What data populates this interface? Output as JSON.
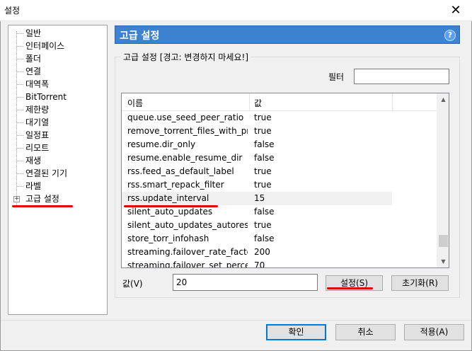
{
  "window": {
    "title": "설정",
    "close_glyph": "✕"
  },
  "tree": {
    "items": [
      {
        "label": "일반"
      },
      {
        "label": "인터페이스"
      },
      {
        "label": "폴더"
      },
      {
        "label": "연결"
      },
      {
        "label": "대역폭"
      },
      {
        "label": "BitTorrent"
      },
      {
        "label": "제한량"
      },
      {
        "label": "대기열"
      },
      {
        "label": "일정표"
      },
      {
        "label": "리모트"
      },
      {
        "label": "재생"
      },
      {
        "label": "연결된 기기"
      },
      {
        "label": "라벨"
      },
      {
        "label": "고급 설정",
        "expander": "+"
      }
    ]
  },
  "header": {
    "title": "고급 설정",
    "help_glyph": "?"
  },
  "group": {
    "label": "고급 설정 [경고: 변경하지 마세요!]"
  },
  "filter": {
    "label": "필터",
    "value": ""
  },
  "list": {
    "columns": [
      "이름",
      "값"
    ],
    "rows": [
      {
        "name": "queue.use_seed_peer_ratio",
        "value": "true"
      },
      {
        "name": "remove_torrent_files_with_priv...",
        "value": "true"
      },
      {
        "name": "resume.dir_only",
        "value": "false"
      },
      {
        "name": "resume.enable_resume_dir",
        "value": "false"
      },
      {
        "name": "rss.feed_as_default_label",
        "value": "true"
      },
      {
        "name": "rss.smart_repack_filter",
        "value": "true"
      },
      {
        "name": "rss.update_interval",
        "value": "15"
      },
      {
        "name": "silent_auto_updates",
        "value": "false"
      },
      {
        "name": "silent_auto_updates_autorestart",
        "value": "true"
      },
      {
        "name": "store_torr_infohash",
        "value": "false"
      },
      {
        "name": "streaming.failover_rate_factor",
        "value": "200"
      },
      {
        "name": "streaming.failover_set_percent",
        "value": "70"
      }
    ],
    "selected_index": 6,
    "scroll_up_glyph": "▲",
    "scroll_down_glyph": "▼"
  },
  "value_row": {
    "label": "값(V)",
    "value": "20",
    "set_button": "설정(S)",
    "reset_button": "초기화(R)"
  },
  "footer": {
    "ok": "확인",
    "cancel": "취소",
    "apply": "적용(A)"
  },
  "colors": {
    "header_blue": "#3d81d1",
    "annotation_red": "#e30000"
  }
}
